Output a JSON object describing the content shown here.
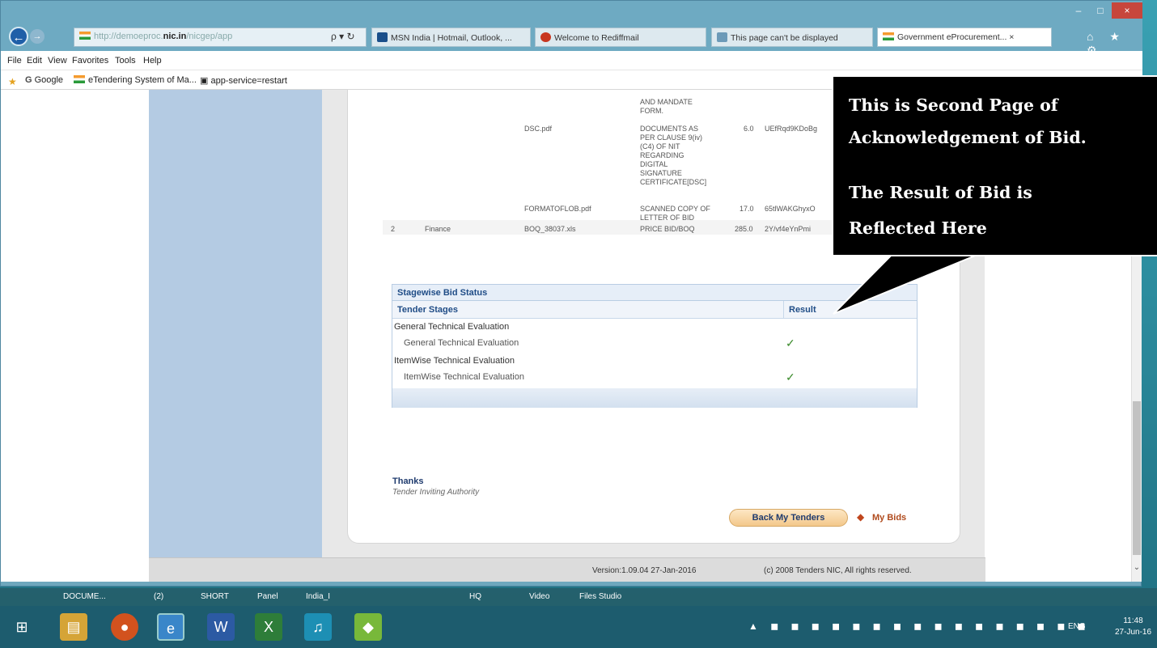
{
  "window": {
    "minimize": "–",
    "maximize": "□",
    "close": "×"
  },
  "browser": {
    "address_prefix": "http://demoeproc.",
    "address_strong": "nic.in",
    "address_suffix": "/nicgep/app",
    "address_tools": "ρ ▾ ↻",
    "back": "←",
    "forward": "→",
    "tabs": [
      {
        "label": "MSN India | Hotmail, Outlook, ..."
      },
      {
        "label": "Welcome to Rediffmail"
      },
      {
        "label": "This page can't be displayed"
      },
      {
        "label": "Government eProcurement... ×"
      }
    ],
    "toolbar_icons": "⌂ ★ ⚙",
    "menu": [
      "File",
      "Edit",
      "View",
      "Favorites",
      "Tools",
      "Help"
    ],
    "favorites": [
      "Google",
      "eTendering System of Ma...",
      "app-service=restart"
    ]
  },
  "doc_table": {
    "rows": [
      {
        "file": "",
        "desc": "AND MANDATE\nFORM.",
        "size": "",
        "hash": ""
      },
      {
        "file": "DSC.pdf",
        "desc": "DOCUMENTS AS\nPER CLAUSE 9(iv)\n(C4) OF NIT\nREGARDING\nDIGITAL\nSIGNATURE\nCERTIFICATE[DSC]",
        "size": "6.0",
        "hash": "UEfRqd9KDoBg"
      },
      {
        "file": "FORMATOFLOB.pdf",
        "desc": "SCANNED COPY OF\nLETTER OF BID",
        "size": "17.0",
        "hash": "65tlWAKGhyxO"
      },
      {
        "sno": "2",
        "cover": "Finance",
        "file": "BOQ_38037.xls",
        "desc": "PRICE BID/BOQ",
        "size": "285.0",
        "hash": "2Y/vf4eYnPmi"
      }
    ]
  },
  "stage_status": {
    "title": "Stagewise Bid Status",
    "col_stage": "Tender Stages",
    "col_result": "Result",
    "rows": [
      {
        "label": "General Technical Evaluation",
        "check": ""
      },
      {
        "label": "General Technical Evaluation",
        "check": "✓"
      },
      {
        "label": "ItemWise Technical Evaluation",
        "check": ""
      },
      {
        "label": "ItemWise Technical Evaluation",
        "check": "✓"
      }
    ]
  },
  "signoff": {
    "thanks": "Thanks",
    "authority": "Tender Inviting Authority"
  },
  "actions": {
    "back_my_tenders": "Back My Tenders",
    "my_bids": "My Bids"
  },
  "footer": {
    "version": "Version:1.09.04 27-Jan-2016",
    "copyright": "(c) 2008 Tenders NIC, All rights reserved."
  },
  "callout": {
    "line1": "This is Second Page of",
    "line2": "Acknowledgement of Bid.",
    "line3": "The Result of Bid is",
    "line4": "Reflected Here"
  },
  "taskbar_strip": [
    "DOCUME...",
    "(2)",
    "SHORT",
    "Panel",
    "India_I",
    "HQ",
    "Video",
    "Files Studio"
  ],
  "taskbar": {
    "tray_icons": "▲ ◼ ◼ ◼ ◼ ◼ ◼ ◼ ◼ ◼ ◼ ◼ ◼ ◼ ◼ ◼ ◼",
    "lang": "ENG",
    "time": "11:48",
    "date": "27-Jun-16"
  }
}
